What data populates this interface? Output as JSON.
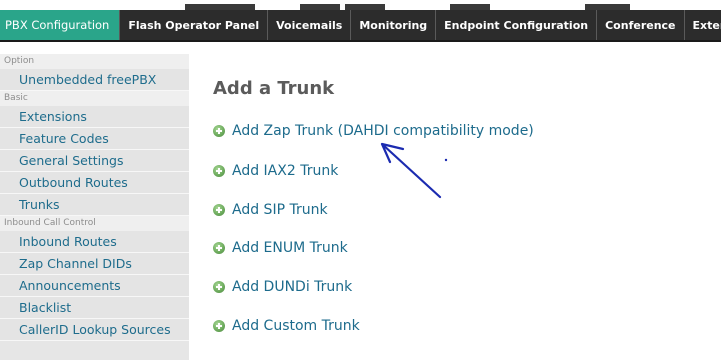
{
  "nav": {
    "tabs": [
      "PBX Configuration",
      "Flash Operator Panel",
      "Voicemails",
      "Monitoring",
      "Endpoint Configuration",
      "Conference",
      "Exten"
    ]
  },
  "sidebar": {
    "sections": [
      {
        "title": "Option",
        "items": [
          "Unembedded freePBX"
        ]
      },
      {
        "title": "Basic",
        "items": [
          "Extensions",
          "Feature Codes",
          "General Settings",
          "Outbound Routes",
          "Trunks"
        ]
      },
      {
        "title": "Inbound Call Control",
        "items": [
          "Inbound Routes",
          "Zap Channel DIDs",
          "Announcements",
          "Blacklist",
          "CallerID Lookup Sources"
        ]
      }
    ]
  },
  "main": {
    "title": "Add a Trunk",
    "trunks": [
      "Add Zap Trunk (DAHDI compatibility mode)",
      "Add IAX2 Trunk",
      "Add SIP Trunk",
      "Add ENUM Trunk",
      "Add DUNDi Trunk",
      "Add Custom Trunk"
    ]
  },
  "colors": {
    "active_tab": "#2aa58a",
    "link": "#1d6b8c",
    "annotation": "#1b2bb0"
  }
}
